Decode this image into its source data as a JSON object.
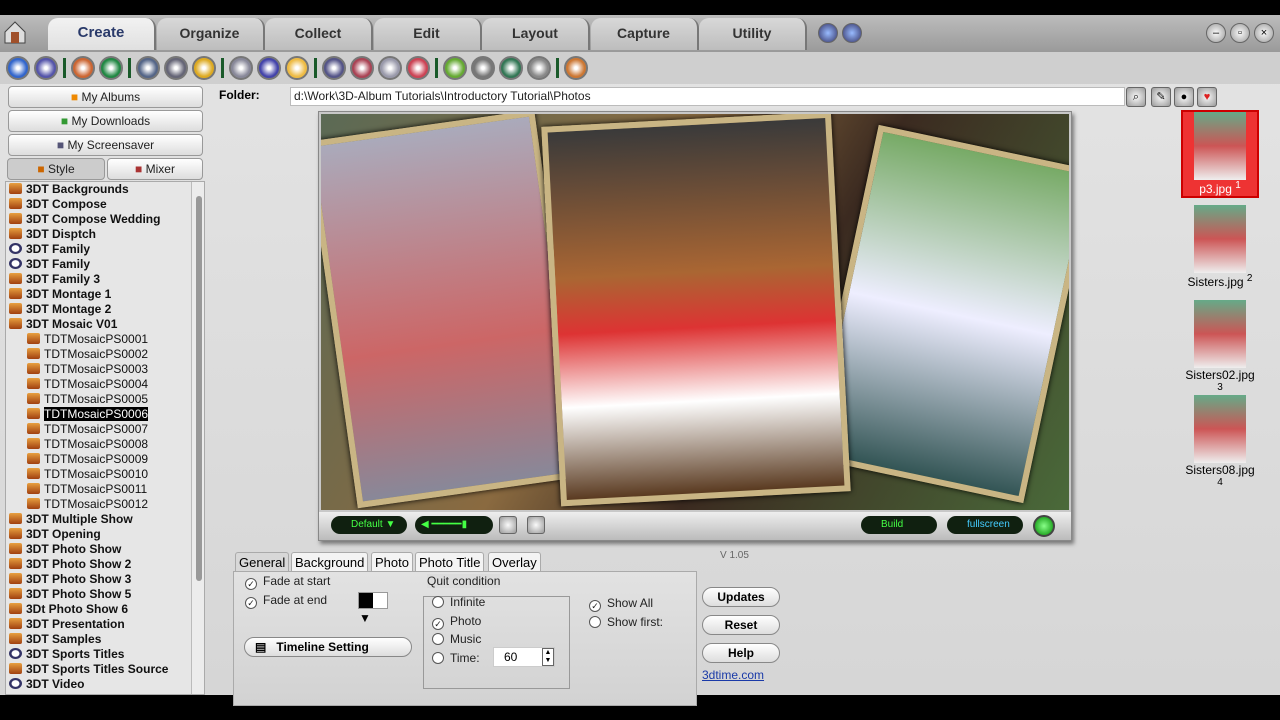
{
  "tabs": [
    "Create",
    "Organize",
    "Collect",
    "Edit",
    "Layout",
    "Capture",
    "Utility"
  ],
  "active_tab": "Create",
  "sidebar": {
    "buttons": [
      "My Albums",
      "My Downloads",
      "My Screensaver"
    ],
    "subtabs": [
      "Style",
      "Mixer"
    ],
    "tree": [
      {
        "label": "3DT Backgrounds",
        "level": 0
      },
      {
        "label": "3DT Compose",
        "level": 0
      },
      {
        "label": "3DT Compose Wedding",
        "level": 0
      },
      {
        "label": "3DT Disptch",
        "level": 0
      },
      {
        "label": "3DT Family",
        "level": 0,
        "icon": "clock"
      },
      {
        "label": "3DT Family",
        "level": 0,
        "icon": "clock"
      },
      {
        "label": "3DT Family 3",
        "level": 0
      },
      {
        "label": "3DT Montage 1",
        "level": 0
      },
      {
        "label": "3DT Montage 2",
        "level": 0
      },
      {
        "label": "3DT Mosaic V01",
        "level": 0,
        "expanded": true
      },
      {
        "label": "TDTMosaicPS0001",
        "level": 1
      },
      {
        "label": "TDTMosaicPS0002",
        "level": 1
      },
      {
        "label": "TDTMosaicPS0003",
        "level": 1
      },
      {
        "label": "TDTMosaicPS0004",
        "level": 1
      },
      {
        "label": "TDTMosaicPS0005",
        "level": 1
      },
      {
        "label": "TDTMosaicPS0006",
        "level": 1,
        "selected": true
      },
      {
        "label": "TDTMosaicPS0007",
        "level": 1
      },
      {
        "label": "TDTMosaicPS0008",
        "level": 1
      },
      {
        "label": "TDTMosaicPS0009",
        "level": 1
      },
      {
        "label": "TDTMosaicPS0010",
        "level": 1
      },
      {
        "label": "TDTMosaicPS0011",
        "level": 1
      },
      {
        "label": "TDTMosaicPS0012",
        "level": 1
      },
      {
        "label": "3DT Multiple Show",
        "level": 0
      },
      {
        "label": "3DT Opening",
        "level": 0
      },
      {
        "label": "3DT Photo Show",
        "level": 0
      },
      {
        "label": "3DT Photo Show 2",
        "level": 0
      },
      {
        "label": "3DT Photo Show 3",
        "level": 0
      },
      {
        "label": "3DT Photo Show 5",
        "level": 0
      },
      {
        "label": "3Dt Photo Show 6",
        "level": 0
      },
      {
        "label": "3DT Presentation",
        "level": 0
      },
      {
        "label": "3DT Samples",
        "level": 0
      },
      {
        "label": "3DT Sports Titles",
        "level": 0,
        "icon": "clock"
      },
      {
        "label": "3DT Sports Titles Source",
        "level": 0
      },
      {
        "label": "3DT Video",
        "level": 0,
        "icon": "clock"
      }
    ]
  },
  "folder": {
    "label": "Folder:",
    "value": "d:\\Work\\3D-Album  Tutorials\\Introductory  Tutorial\\Photos"
  },
  "player": {
    "default_label": "Default",
    "build_label": "Build",
    "fullscreen_label": "fullscreen"
  },
  "thumbnails": [
    {
      "name": "p3.jpg",
      "index": "1",
      "selected": true
    },
    {
      "name": "Sisters.jpg",
      "index": "2"
    },
    {
      "name": "Sisters02.jpg",
      "index": "3"
    },
    {
      "name": "Sisters08.jpg",
      "index": "4"
    }
  ],
  "version": "V 1.05",
  "panel": {
    "tabs": [
      "General",
      "Background",
      "Photo",
      "Photo Title",
      "Overlay"
    ],
    "fade_start": "Fade at start",
    "fade_end": "Fade at end",
    "timeline": "Timeline Setting",
    "quit_title": "Quit condition",
    "quit_options": [
      "Infinite",
      "Photo",
      "Music",
      "Time:"
    ],
    "quit_selected": "Photo",
    "time_value": "60",
    "show_all": "Show All",
    "show_first": "Show first:"
  },
  "buttons": {
    "updates": "Updates",
    "reset": "Reset",
    "help": "Help",
    "link": "3dtime.com"
  }
}
